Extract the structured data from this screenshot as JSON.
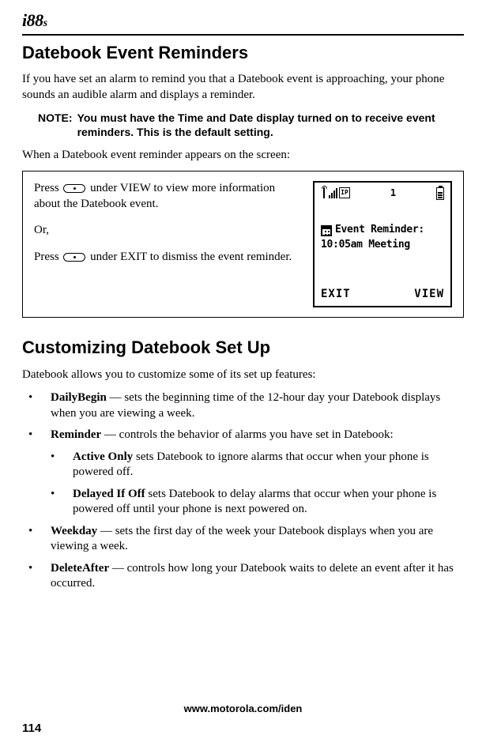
{
  "brand": {
    "model": "88",
    "suffix": "s"
  },
  "section1": {
    "heading": "Datebook Event Reminders",
    "p1": "If you have set an alarm to remind you that a Datebook event is approaching, your phone sounds an audible alarm and displays a reminder.",
    "note_label": "NOTE:",
    "note_body": "You must have the Time and Date display turned on to receive event reminders. This is the default setting.",
    "p2": "When a Datebook event reminder appears on the screen:"
  },
  "instruction": {
    "line1a": "Press ",
    "line1b": " under VIEW to view more information about the Datebook event.",
    "or": "Or,",
    "line2a": "Press ",
    "line2b": " under EXIT to dismiss the event reminder."
  },
  "phone_screen": {
    "ip_label": "IP",
    "one_label": "1",
    "event_label": "Event Reminder:",
    "event_detail": "10:05am Meeting",
    "left_softkey": "EXIT",
    "right_softkey": "VIEW"
  },
  "section2": {
    "heading": "Customizing Datebook Set Up",
    "intro": "Datebook allows you to customize some of its set up features:",
    "items": [
      {
        "term": "DailyBegin",
        "desc": " — sets the beginning time of the 12-hour day your Datebook displays when you are viewing a week."
      },
      {
        "term": "Reminder",
        "desc": " — controls the behavior of alarms you have set in Datebook:",
        "sub": [
          {
            "term": "Active Only",
            "desc": " sets Datebook to ignore alarms that occur when your phone is powered off."
          },
          {
            "term": "Delayed If Off",
            "desc": " sets Datebook to delay alarms that occur when your phone is powered off until your phone is next powered on."
          }
        ]
      },
      {
        "term": "Weekday",
        "desc": " — sets the first day of the week your Datebook displays when you are viewing a week."
      },
      {
        "term": "DeleteAfter",
        "desc": " — controls how long your Datebook waits to delete an event after it has occurred."
      }
    ]
  },
  "footer": {
    "url": "www.motorola.com/iden",
    "page": "114"
  }
}
